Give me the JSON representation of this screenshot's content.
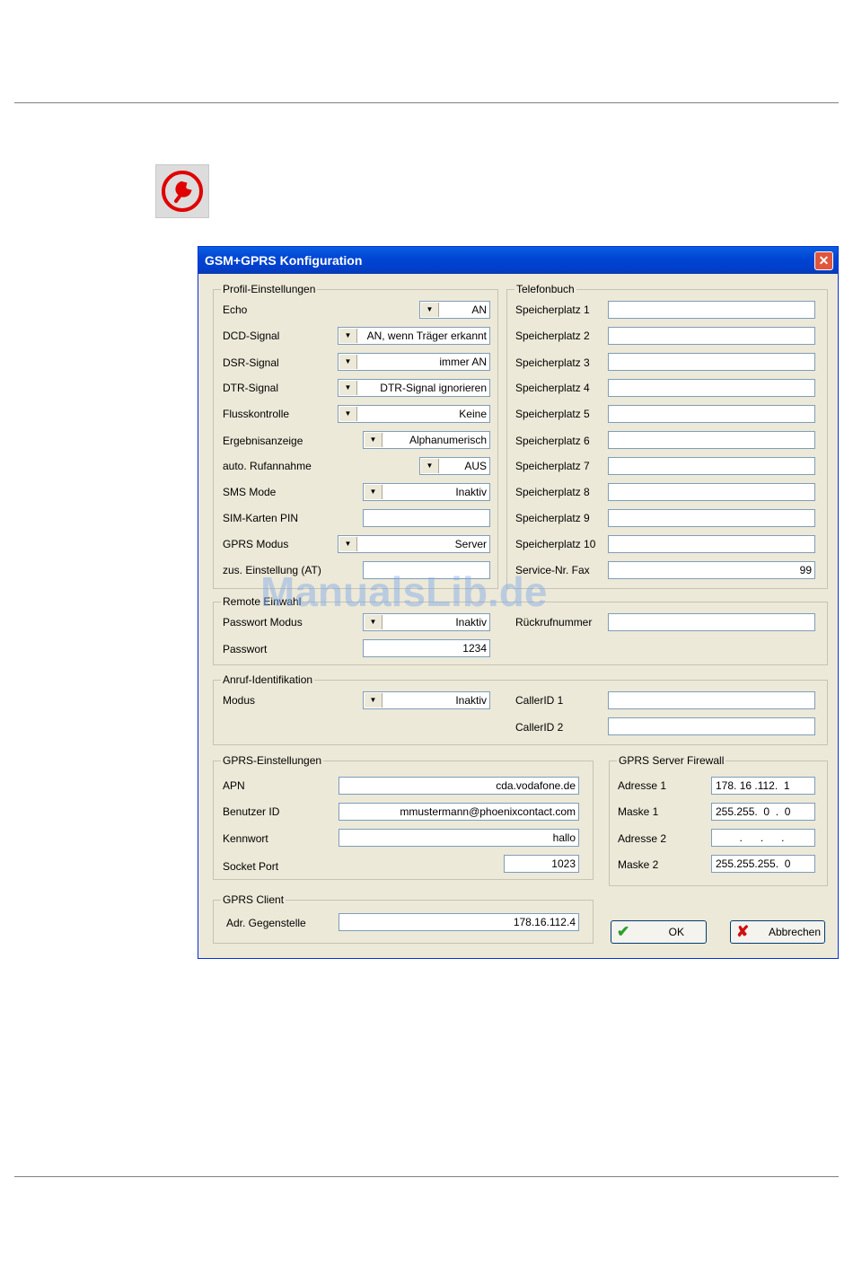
{
  "dialog": {
    "title": "GSM+GPRS Konfiguration",
    "close": "✕",
    "profil": {
      "legend": "Profil-Einstellungen",
      "rows": [
        {
          "label": "Echo",
          "value": "AN"
        },
        {
          "label": "DCD-Signal",
          "value": "AN, wenn Träger erkannt"
        },
        {
          "label": "DSR-Signal",
          "value": "immer AN"
        },
        {
          "label": "DTR-Signal",
          "value": "DTR-Signal ignorieren"
        },
        {
          "label": "Flusskontrolle",
          "value": "Keine"
        },
        {
          "label": "Ergebnisanzeige",
          "value": "Alphanumerisch"
        },
        {
          "label": "auto. Rufannahme",
          "value": "AUS"
        },
        {
          "label": "SMS Mode",
          "value": "Inaktiv"
        },
        {
          "label": "SIM-Karten PIN",
          "value": ""
        },
        {
          "label": "GPRS Modus",
          "value": "Server"
        },
        {
          "label": "zus. Einstellung (AT)",
          "value": ""
        }
      ]
    },
    "telefonbuch": {
      "legend": "Telefonbuch",
      "rows": [
        {
          "label": "Speicherplatz 1",
          "value": ""
        },
        {
          "label": "Speicherplatz 2",
          "value": ""
        },
        {
          "label": "Speicherplatz 3",
          "value": ""
        },
        {
          "label": "Speicherplatz 4",
          "value": ""
        },
        {
          "label": "Speicherplatz 5",
          "value": ""
        },
        {
          "label": "Speicherplatz 6",
          "value": ""
        },
        {
          "label": "Speicherplatz 7",
          "value": ""
        },
        {
          "label": "Speicherplatz 8",
          "value": ""
        },
        {
          "label": "Speicherplatz 9",
          "value": ""
        },
        {
          "label": "Speicherplatz 10",
          "value": ""
        },
        {
          "label": "Service-Nr. Fax",
          "value": "99"
        }
      ]
    },
    "remote": {
      "legend": "Remote Einwahl",
      "passwort_modus_label": "Passwort Modus",
      "passwort_modus_value": "Inaktiv",
      "passwort_label": "Passwort",
      "passwort_value": "1234",
      "rueckruf_label": "Rückrufnummer",
      "rueckruf_value": ""
    },
    "anruf": {
      "legend": "Anruf-Identifikation",
      "modus_label": "Modus",
      "modus_value": "Inaktiv",
      "caller1_label": "CallerID 1",
      "caller1_value": "",
      "caller2_label": "CallerID 2",
      "caller2_value": ""
    },
    "gprs": {
      "legend": "GPRS-Einstellungen",
      "apn_label": "APN",
      "apn_value": "cda.vodafone.de",
      "benutzer_label": "Benutzer ID",
      "benutzer_value": "mmustermann@phoenixcontact.com",
      "kennwort_label": "Kennwort",
      "kennwort_value": "hallo",
      "socket_label": "Socket Port",
      "socket_value": "1023"
    },
    "firewall": {
      "legend": "GPRS Server Firewall",
      "adresse1_label": "Adresse 1",
      "adresse1_value": "178. 16 .112.  1",
      "maske1_label": "Maske 1",
      "maske1_value": "255.255.  0  .  0",
      "adresse2_label": "Adresse 2",
      "adresse2_value": ".      .      .",
      "maske2_label": "Maske 2",
      "maske2_value": "255.255.255.  0"
    },
    "client": {
      "legend": "GPRS Client",
      "adr_label": "Adr. Gegenstelle",
      "adr_value": "178.16.112.4"
    },
    "buttons": {
      "ok": "OK",
      "cancel": "Abbrechen"
    }
  },
  "watermark": "ManualsLib.de",
  "colors": {
    "dialog_bg": "#ece9d8",
    "titlebar": "#0046d5",
    "ok_check": "#2aa02a",
    "cancel_x": "#d01010",
    "tool_icon": "#e00000"
  }
}
